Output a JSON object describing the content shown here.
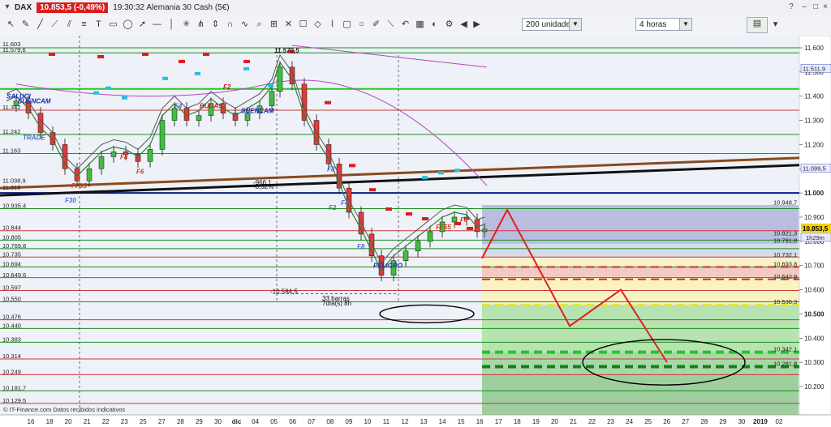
{
  "window": {
    "symbol": "DAX",
    "price_badge": "10.853,5 (-0,49%)",
    "info": "19:30:32 Alemania 30 Cash (5€)"
  },
  "toolbar": {
    "units": "200 unidades",
    "period": "4 horas"
  },
  "chart_data": {
    "type": "candlestick",
    "title": "",
    "y_axis_ticks": [
      11.6,
      11.5,
      11.4,
      11.3,
      11.2,
      11.1,
      11.0,
      10.9,
      10.8,
      10.7,
      10.6,
      10.5,
      10.4,
      10.3,
      10.2
    ],
    "y_axis_tick_labels": [
      "11.600",
      "11.500",
      "11.400",
      "11.300",
      "11.200",
      "11.100",
      "11.000",
      "10.900",
      "10.800",
      "10.700",
      "10.600",
      "10.500",
      "10.400",
      "10.300",
      "10.200"
    ],
    "x_axis_labels": [
      "19",
      "20",
      "21",
      "22",
      "23",
      "25",
      "26",
      "27",
      "28",
      "29",
      "30",
      "dic",
      "04",
      "05",
      "06",
      "07",
      "08",
      "09",
      "10",
      "11",
      "12",
      "13",
      "14",
      "15",
      "16",
      "17",
      "18",
      "19",
      "20",
      "21",
      "22",
      "23",
      "24",
      "25",
      "26",
      "27",
      "28",
      "29",
      "30",
      "31",
      "2019",
      "02"
    ],
    "x_axis_labels_display": [
      "16",
      "18",
      "20",
      "21",
      "22",
      "23",
      "25",
      "27",
      "28",
      "29",
      "30",
      "dic",
      "04",
      "05",
      "06",
      "07",
      "08",
      "09",
      "10",
      "11",
      "12",
      "13",
      "14",
      "15",
      "16",
      "17",
      "18",
      "19",
      "20",
      "21",
      "22",
      "23",
      "24",
      "25",
      "26",
      "27",
      "28",
      "29",
      "30",
      "2019",
      "02"
    ],
    "left_levels": [
      "11.603",
      "11.579,6",
      "11.342",
      "11.242",
      "11.163",
      "11.038,9",
      "11.010",
      "10.935,4",
      "10.844",
      "10.805",
      "10.769,8",
      "10.735",
      "10.694",
      "10.649,6",
      "10.597",
      "10.550",
      "10.476",
      "10.440",
      "10.383",
      "10.314",
      "10.249",
      "10.181,7",
      "10.129,5"
    ],
    "right_levels": [
      "11.511,9",
      "11.099,5",
      "10.948,7",
      "10.821,3",
      "10.791,8",
      "10.732,1",
      "10.693,8",
      "10.642,9",
      "10.538,3",
      "10.342,1",
      "10.281,8"
    ],
    "current_price": "10.853,5",
    "time_remaining": "1h29m",
    "annotations": [
      "11.570,5",
      "SALUCI",
      "SUENCAM",
      "TRADE",
      "FF35",
      "F8",
      "F6",
      "F30",
      "F2",
      "F4",
      "BUDAS",
      "SUENCAM",
      "F8",
      "F2",
      "F4",
      "F8",
      "FF55",
      "F8",
      "PELIGRO",
      "-966,1",
      "-8,52%",
      "-10.584,5",
      "33 barras",
      "7día(s) 8h",
      "11.000"
    ],
    "highs_lows": {
      "high": 11570.5,
      "low": 10584.5
    },
    "footer": "© IT-Finance.com  Datos recibidos indicativos"
  }
}
